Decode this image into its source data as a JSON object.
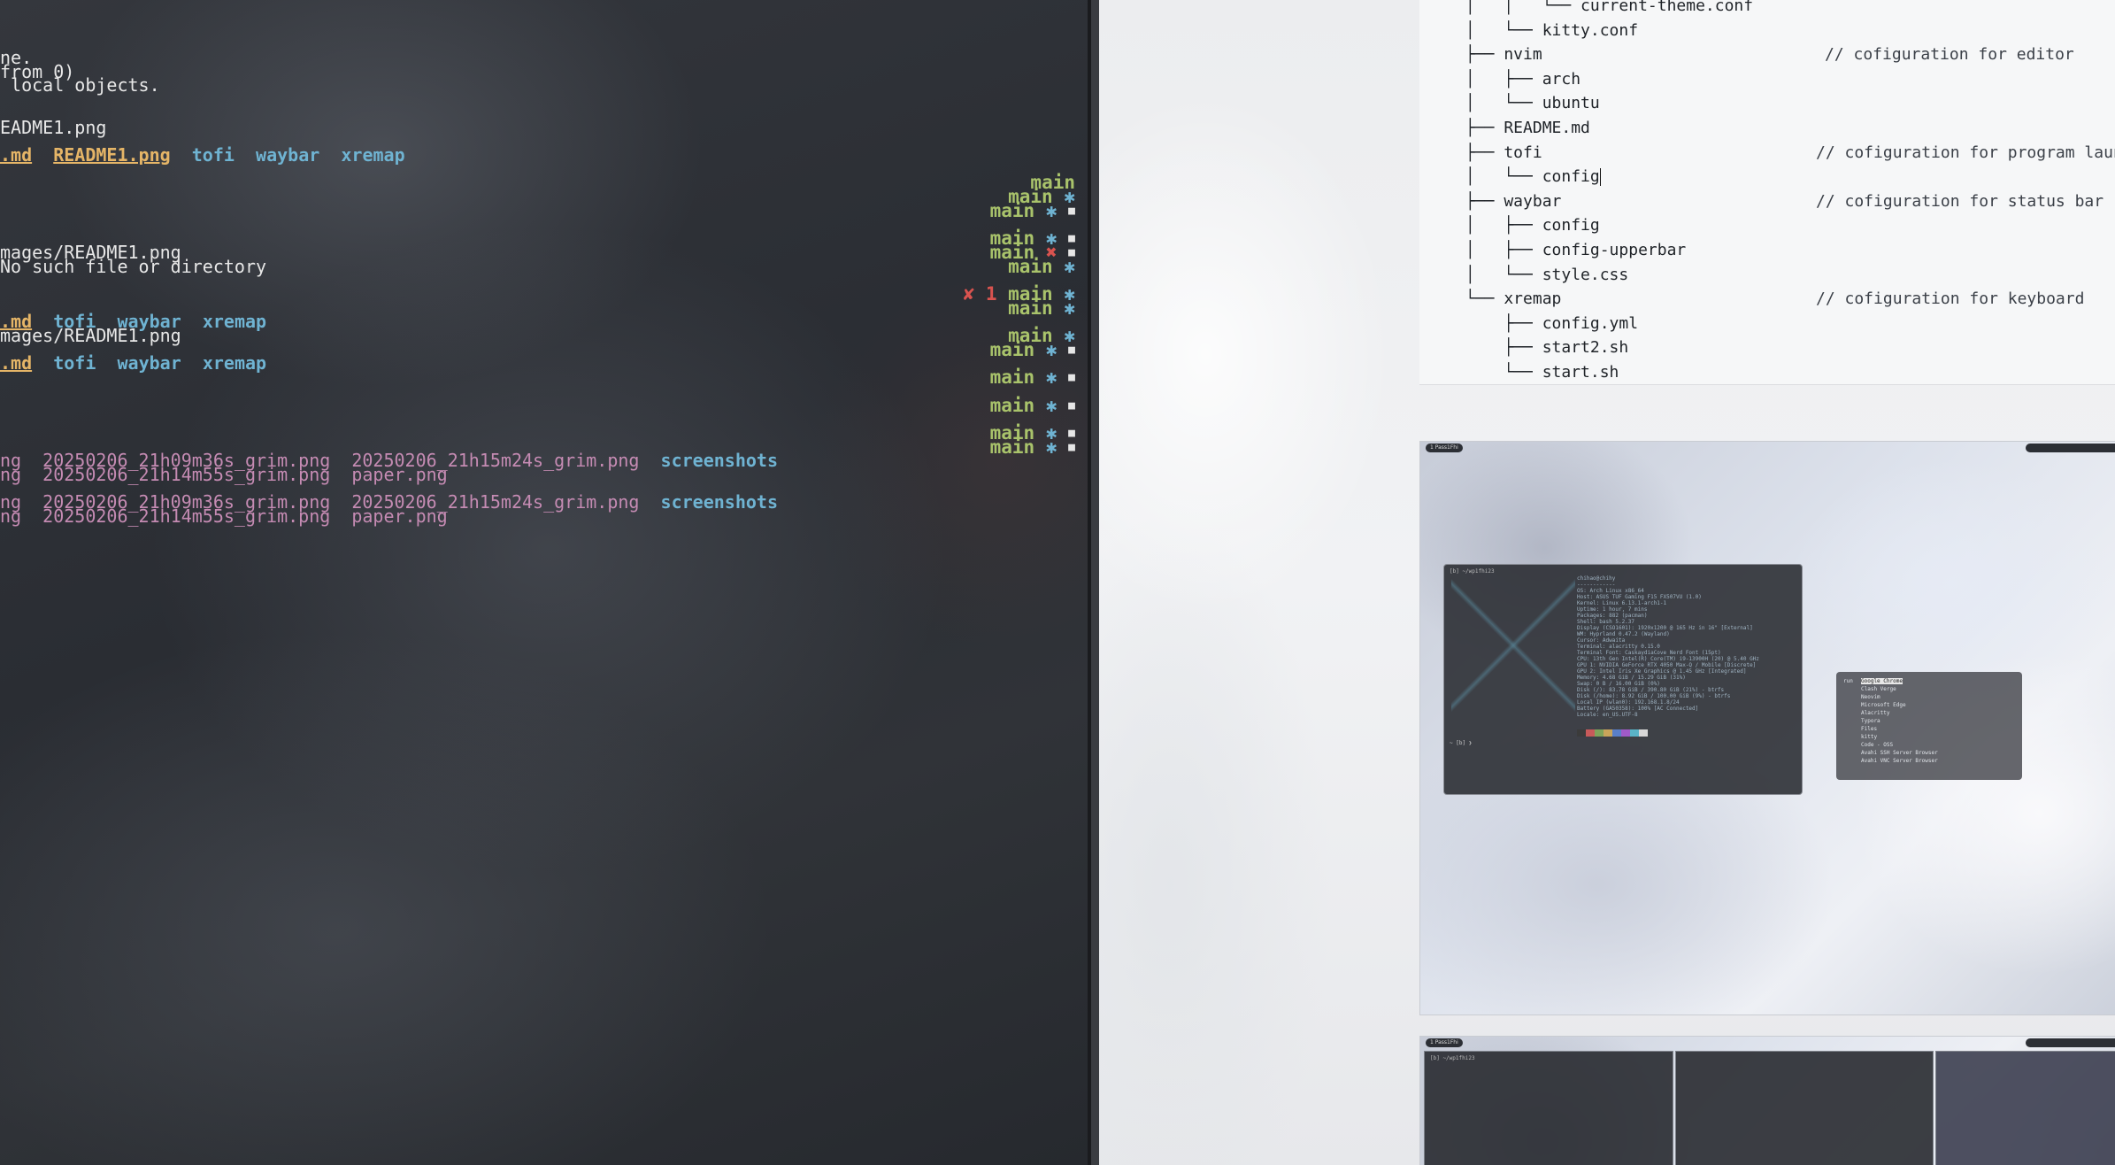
{
  "terminal": {
    "lines": [
      {
        "segments": [
          {
            "t": "ne.",
            "c": "w"
          }
        ]
      },
      {
        "segments": [
          {
            "t": "from 0)",
            "c": "w"
          }
        ]
      },
      {
        "segments": [
          {
            "t": " local objects.",
            "c": "w"
          }
        ]
      },
      {
        "segments": []
      },
      {
        "segments": []
      },
      {
        "segments": [
          {
            "t": "EADME1.png",
            "c": "w"
          }
        ]
      },
      {
        "segments": []
      },
      {
        "segments": [
          {
            "t": ".md",
            "c": "yl"
          },
          {
            "t": "  ",
            "c": "w"
          },
          {
            "t": "README1.png",
            "c": "yl"
          },
          {
            "t": "  ",
            "c": "w"
          },
          {
            "t": "tofi",
            "c": "bl"
          },
          {
            "t": "  ",
            "c": "w"
          },
          {
            "t": "waybar",
            "c": "bl"
          },
          {
            "t": "  ",
            "c": "w"
          },
          {
            "t": "xremap",
            "c": "bl"
          }
        ]
      },
      {
        "segments": []
      },
      {
        "segments": []
      },
      {
        "segments": []
      },
      {
        "segments": []
      },
      {
        "segments": []
      },
      {
        "segments": []
      },
      {
        "segments": [
          {
            "t": "mages/README1.png",
            "c": "w"
          }
        ]
      },
      {
        "segments": [
          {
            "t": "No such file or directory",
            "c": "w"
          }
        ]
      },
      {
        "segments": []
      },
      {
        "segments": []
      },
      {
        "segments": []
      },
      {
        "segments": [
          {
            "t": ".md",
            "c": "yl"
          },
          {
            "t": "  ",
            "c": "w"
          },
          {
            "t": "tofi",
            "c": "bl"
          },
          {
            "t": "  ",
            "c": "w"
          },
          {
            "t": "waybar",
            "c": "bl"
          },
          {
            "t": "  ",
            "c": "w"
          },
          {
            "t": "xremap",
            "c": "bl"
          }
        ]
      },
      {
        "segments": [
          {
            "t": "mages/README1.png",
            "c": "w"
          }
        ]
      },
      {
        "segments": []
      },
      {
        "segments": [
          {
            "t": ".md",
            "c": "yl"
          },
          {
            "t": "  ",
            "c": "w"
          },
          {
            "t": "tofi",
            "c": "bl"
          },
          {
            "t": "  ",
            "c": "w"
          },
          {
            "t": "waybar",
            "c": "bl"
          },
          {
            "t": "  ",
            "c": "w"
          },
          {
            "t": "xremap",
            "c": "bl"
          }
        ]
      },
      {
        "segments": []
      },
      {
        "segments": []
      },
      {
        "segments": []
      },
      {
        "segments": []
      },
      {
        "segments": []
      },
      {
        "segments": []
      },
      {
        "segments": [
          {
            "t": "ng  20250206_21h09m36s_grim.png  20250206_21h15m24s_grim.png  ",
            "c": "pk"
          },
          {
            "t": "screenshots",
            "c": "bl"
          }
        ]
      },
      {
        "segments": [
          {
            "t": "ng  20250206_21h14m55s_grim.png  paper.png",
            "c": "pk"
          }
        ]
      },
      {
        "segments": []
      },
      {
        "segments": [
          {
            "t": "ng  20250206_21h09m36s_grim.png  20250206_21h15m24s_grim.png  ",
            "c": "pk"
          },
          {
            "t": "screenshots",
            "c": "bl"
          }
        ]
      },
      {
        "segments": [
          {
            "t": "ng  20250206_21h14m55s_grim.png  paper.png",
            "c": "pk"
          }
        ]
      }
    ],
    "prompts": [
      {
        "row": 8,
        "branch": "main",
        "star": false,
        "sq": false,
        "err": ""
      },
      {
        "row": 9,
        "branch": "main",
        "star": true,
        "sq": false,
        "err": ""
      },
      {
        "row": 10,
        "branch": "main",
        "star": true,
        "sq": true,
        "err": ""
      },
      {
        "row": 12,
        "branch": "main",
        "star": true,
        "sq": true,
        "err": ""
      },
      {
        "row": 13,
        "branch": "main",
        "star": "x",
        "sq": true,
        "err": ""
      },
      {
        "row": 14,
        "branch": "main",
        "star": true,
        "sq": false,
        "err": ""
      },
      {
        "row": 16,
        "branch": "main",
        "star": true,
        "sq": false,
        "err": "✘ 1"
      },
      {
        "row": 17,
        "branch": "main",
        "star": true,
        "sq": false,
        "err": ""
      },
      {
        "row": 19,
        "branch": "main",
        "star": true,
        "sq": false,
        "err": ""
      },
      {
        "row": 20,
        "branch": "main",
        "star": true,
        "sq": true,
        "err": ""
      },
      {
        "row": 22,
        "branch": "main",
        "star": true,
        "sq": true,
        "err": ""
      },
      {
        "row": 24,
        "branch": "main",
        "star": true,
        "sq": true,
        "err": ""
      },
      {
        "row": 26,
        "branch": "main",
        "star": true,
        "sq": true,
        "err": ""
      },
      {
        "row": 27,
        "branch": "main",
        "star": true,
        "sq": true,
        "err": ""
      }
    ],
    "colors": {
      "branch": "#a9c36b",
      "star": "#6fb3d2",
      "error": "#d9534f",
      "yellow": "#e5b567",
      "blue": "#6fb3d2",
      "pink": "#c58bb3"
    }
  },
  "doc": {
    "tree": [
      {
        "text": "│   │   └── current-theme.conf",
        "comment": ""
      },
      {
        "text": "│   └── kitty.conf",
        "comment": ""
      },
      {
        "text": "├── nvim",
        "comment": "// cofiguration for editor"
      },
      {
        "text": "│   ├── arch",
        "comment": ""
      },
      {
        "text": "│   └── ubuntu",
        "comment": ""
      },
      {
        "text": "├── README.md",
        "comment": ""
      },
      {
        "text": "├── tofi",
        "comment": "// cofiguration for program launcher"
      },
      {
        "text": "│   └── config",
        "comment": "",
        "cursor": true
      },
      {
        "text": "├── waybar",
        "comment": "// cofiguration for status bar"
      },
      {
        "text": "│   ├── config",
        "comment": ""
      },
      {
        "text": "│   ├── config-upperbar",
        "comment": ""
      },
      {
        "text": "│   └── style.css",
        "comment": ""
      },
      {
        "text": "└── xremap",
        "comment": "// cofiguration for keyboard"
      },
      {
        "text": "    ├── config.yml",
        "comment": ""
      },
      {
        "text": "    ├── start2.sh",
        "comment": ""
      },
      {
        "text": "    └── start.sh",
        "comment": ""
      }
    ],
    "shot1": {
      "workspace": "1 Pass1Fhi",
      "terminal_title": "[b] ~/wp1fhi23",
      "info_lines": "chihao@chihy\n------------\nOS: Arch Linux x86_64\nHost: ASUS TUF Gaming F15 FX507VU (1.0)\nKernel: Linux 6.13.1-arch1-1\nUptime: 1 hour, 7 mins\nPackages: 882 (pacman)\nShell: bash 5.2.37\nDisplay (CSO1601): 1920x1200 @ 165 Hz in 16\" [External]\nWM: Hyprland 0.47.2 (Wayland)\nCursor: Adwaita\nTerminal: alacritty 0.15.0\nTerminal Font: CaskaydiaCove Nerd Font (15pt)\nCPU: 13th Gen Intel(R) Core(TM) i9-13900H (20) @ 5.40 GHz\nGPU 1: NVIDIA GeForce RTX 4050 Max-Q / Mobile [Discrete]\nGPU 2: Intel Iris Xe Graphics @ 1.45 GHz [Integrated]\nMemory: 4.68 GiB / 15.29 GiB (31%)\nSwap: 0 B / 16.00 GiB (0%)\nDisk (/): 83.78 GiB / 390.80 GiB (21%) - btrfs\nDisk (/home): 8.92 GiB / 100.00 GiB (9%) - btrfs\nLocal IP (wlan0): 192.168.1.8/24\nBattery (GA50358): 100% [AC Connected]\nLocale: en_US.UTF-8",
      "prompt": "~ [b] ❯",
      "launcher_items": [
        "Google Chrome",
        "Clash Verge",
        "Neovim",
        "Microsoft Edge",
        "Alacritty",
        "Typora",
        "Files",
        "kitty",
        "Code - OSS",
        "Avahi SSH Server Browser",
        "Avahi VNC Server Browser"
      ],
      "launcher_prompt": "run"
    },
    "shot2": {
      "workspace": "1 Pass1Fhi",
      "terminal_title": "[b] ~/wp1fhi23"
    },
    "swatches": [
      "#3b3b3b",
      "#c85a5a",
      "#7fa35a",
      "#c8a45a",
      "#5a7fc8",
      "#a05ac8",
      "#5ab4c8",
      "#d8d8d8"
    ]
  }
}
